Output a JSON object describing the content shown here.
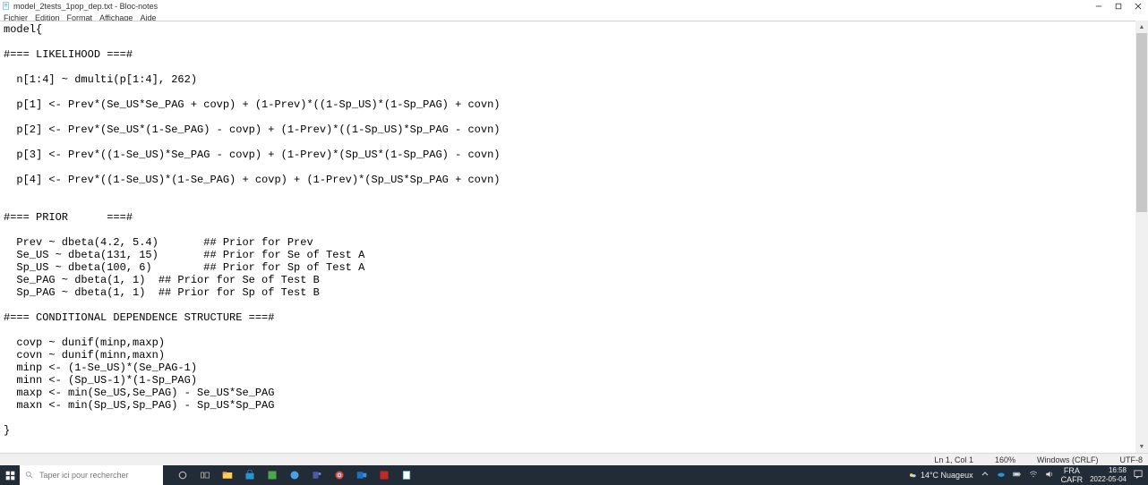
{
  "window": {
    "title": "model_2tests_1pop_dep.txt - Bloc-notes"
  },
  "menubar": {
    "file": "Fichier",
    "edit": "Edition",
    "format": "Format",
    "view": "Affichage",
    "help": "Aide"
  },
  "editor": {
    "content": "model{\n\n#=== LIKELIHOOD ===#\n\n  n[1:4] ~ dmulti(p[1:4], 262)\n\n  p[1] <- Prev*(Se_US*Se_PAG + covp) + (1-Prev)*((1-Sp_US)*(1-Sp_PAG) + covn)\n\n  p[2] <- Prev*(Se_US*(1-Se_PAG) - covp) + (1-Prev)*((1-Sp_US)*Sp_PAG - covn)\n\n  p[3] <- Prev*((1-Se_US)*Se_PAG - covp) + (1-Prev)*(Sp_US*(1-Sp_PAG) - covn)\n\n  p[4] <- Prev*((1-Se_US)*(1-Se_PAG) + covp) + (1-Prev)*(Sp_US*Sp_PAG + covn)\n\n\n#=== PRIOR      ===#\n\n  Prev ~ dbeta(4.2, 5.4)       ## Prior for Prev\n  Se_US ~ dbeta(131, 15)       ## Prior for Se of Test A\n  Sp_US ~ dbeta(100, 6)        ## Prior for Sp of Test A\n  Se_PAG ~ dbeta(1, 1)  ## Prior for Se of Test B\n  Sp_PAG ~ dbeta(1, 1)  ## Prior for Sp of Test B\n\n#=== CONDITIONAL DEPENDENCE STRUCTURE ===#\n\n  covp ~ dunif(minp,maxp)\n  covn ~ dunif(minn,maxn)\n  minp <- (1-Se_US)*(Se_PAG-1)\n  minn <- (Sp_US-1)*(1-Sp_PAG)\n  maxp <- min(Se_US,Se_PAG) - Se_US*Se_PAG\n  maxn <- min(Sp_US,Sp_PAG) - Sp_US*Sp_PAG\n\n}"
  },
  "statusbar": {
    "position": "Ln 1, Col 1",
    "zoom": "160%",
    "eol": "Windows (CRLF)",
    "encoding": "UTF-8"
  },
  "taskbar": {
    "search_placeholder": "Taper ici pour rechercher",
    "weather": "14°C Nuageux",
    "lang1": "FRA",
    "lang2": "CAFR",
    "time": "16:58",
    "date": "2022-05-04"
  }
}
